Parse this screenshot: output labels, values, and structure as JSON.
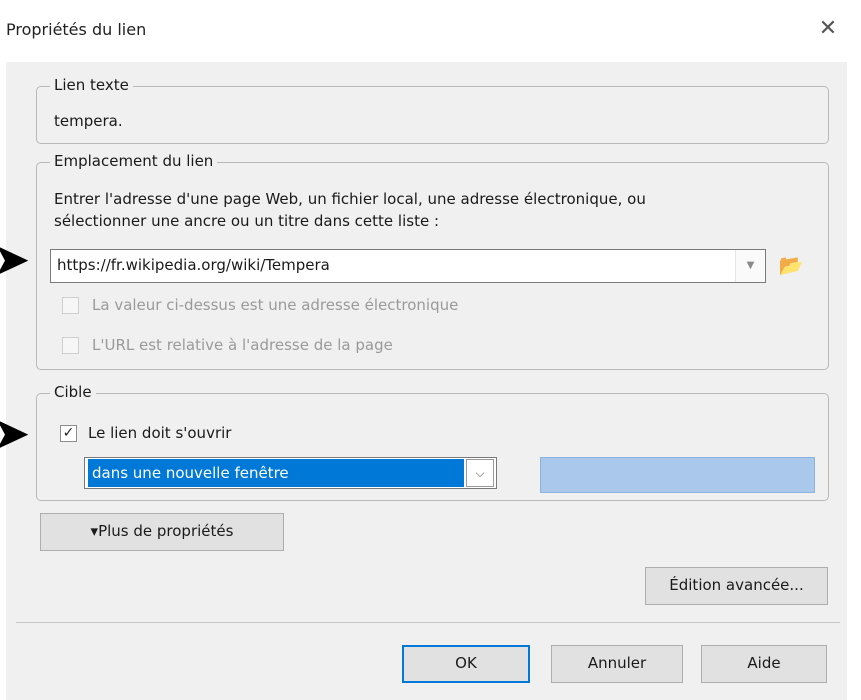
{
  "window": {
    "title": "Propriétés du lien",
    "close_glyph": "✕"
  },
  "link_text_group": {
    "legend": "Lien texte",
    "value": "tempera."
  },
  "location_group": {
    "legend": "Emplacement du lien",
    "instruction_line1": "Entrer l'adresse d'une page Web, un fichier local, une adresse électronique, ou",
    "instruction_line2": "sélectionner une ancre ou un titre dans cette liste :",
    "url_value": "https://fr.wikipedia.org/wiki/Tempera",
    "dropdown_glyph": "▼",
    "folder_icon_glyph": "📂",
    "checkbox_email_label": "La valeur ci-dessus est une adresse électronique",
    "checkbox_relative_label": "L'URL est relative à l'adresse de la page"
  },
  "target_group": {
    "legend": "Cible",
    "checkbox_label": "Le lien doit s'ouvrir",
    "checkbox_checked_glyph": "✓",
    "select_value": "dans une nouvelle fenêtre",
    "select_arrow": "⌵"
  },
  "more_properties_label": "▾Plus de propriétés",
  "advanced_edit_label": "Édition avancée...",
  "buttons": {
    "ok": "OK",
    "cancel": "Annuler",
    "help": "Aide"
  },
  "annotations": {
    "arrow_glyph": "➤"
  },
  "colors": {
    "accent": "#0078d7",
    "dialog_bg": "#f0f0f0",
    "target_field": "#a9c8ec"
  }
}
